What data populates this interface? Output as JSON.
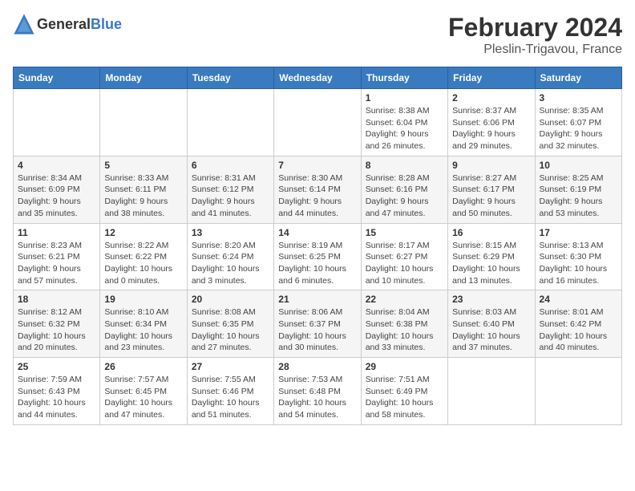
{
  "header": {
    "logo_general": "General",
    "logo_blue": "Blue",
    "main_title": "February 2024",
    "subtitle": "Pleslin-Trigavou, France"
  },
  "days_of_week": [
    "Sunday",
    "Monday",
    "Tuesday",
    "Wednesday",
    "Thursday",
    "Friday",
    "Saturday"
  ],
  "weeks": [
    [
      {
        "day": "",
        "info": ""
      },
      {
        "day": "",
        "info": ""
      },
      {
        "day": "",
        "info": ""
      },
      {
        "day": "",
        "info": ""
      },
      {
        "day": "1",
        "info": "Sunrise: 8:38 AM\nSunset: 6:04 PM\nDaylight: 9 hours and 26 minutes."
      },
      {
        "day": "2",
        "info": "Sunrise: 8:37 AM\nSunset: 6:06 PM\nDaylight: 9 hours and 29 minutes."
      },
      {
        "day": "3",
        "info": "Sunrise: 8:35 AM\nSunset: 6:07 PM\nDaylight: 9 hours and 32 minutes."
      }
    ],
    [
      {
        "day": "4",
        "info": "Sunrise: 8:34 AM\nSunset: 6:09 PM\nDaylight: 9 hours and 35 minutes."
      },
      {
        "day": "5",
        "info": "Sunrise: 8:33 AM\nSunset: 6:11 PM\nDaylight: 9 hours and 38 minutes."
      },
      {
        "day": "6",
        "info": "Sunrise: 8:31 AM\nSunset: 6:12 PM\nDaylight: 9 hours and 41 minutes."
      },
      {
        "day": "7",
        "info": "Sunrise: 8:30 AM\nSunset: 6:14 PM\nDaylight: 9 hours and 44 minutes."
      },
      {
        "day": "8",
        "info": "Sunrise: 8:28 AM\nSunset: 6:16 PM\nDaylight: 9 hours and 47 minutes."
      },
      {
        "day": "9",
        "info": "Sunrise: 8:27 AM\nSunset: 6:17 PM\nDaylight: 9 hours and 50 minutes."
      },
      {
        "day": "10",
        "info": "Sunrise: 8:25 AM\nSunset: 6:19 PM\nDaylight: 9 hours and 53 minutes."
      }
    ],
    [
      {
        "day": "11",
        "info": "Sunrise: 8:23 AM\nSunset: 6:21 PM\nDaylight: 9 hours and 57 minutes."
      },
      {
        "day": "12",
        "info": "Sunrise: 8:22 AM\nSunset: 6:22 PM\nDaylight: 10 hours and 0 minutes."
      },
      {
        "day": "13",
        "info": "Sunrise: 8:20 AM\nSunset: 6:24 PM\nDaylight: 10 hours and 3 minutes."
      },
      {
        "day": "14",
        "info": "Sunrise: 8:19 AM\nSunset: 6:25 PM\nDaylight: 10 hours and 6 minutes."
      },
      {
        "day": "15",
        "info": "Sunrise: 8:17 AM\nSunset: 6:27 PM\nDaylight: 10 hours and 10 minutes."
      },
      {
        "day": "16",
        "info": "Sunrise: 8:15 AM\nSunset: 6:29 PM\nDaylight: 10 hours and 13 minutes."
      },
      {
        "day": "17",
        "info": "Sunrise: 8:13 AM\nSunset: 6:30 PM\nDaylight: 10 hours and 16 minutes."
      }
    ],
    [
      {
        "day": "18",
        "info": "Sunrise: 8:12 AM\nSunset: 6:32 PM\nDaylight: 10 hours and 20 minutes."
      },
      {
        "day": "19",
        "info": "Sunrise: 8:10 AM\nSunset: 6:34 PM\nDaylight: 10 hours and 23 minutes."
      },
      {
        "day": "20",
        "info": "Sunrise: 8:08 AM\nSunset: 6:35 PM\nDaylight: 10 hours and 27 minutes."
      },
      {
        "day": "21",
        "info": "Sunrise: 8:06 AM\nSunset: 6:37 PM\nDaylight: 10 hours and 30 minutes."
      },
      {
        "day": "22",
        "info": "Sunrise: 8:04 AM\nSunset: 6:38 PM\nDaylight: 10 hours and 33 minutes."
      },
      {
        "day": "23",
        "info": "Sunrise: 8:03 AM\nSunset: 6:40 PM\nDaylight: 10 hours and 37 minutes."
      },
      {
        "day": "24",
        "info": "Sunrise: 8:01 AM\nSunset: 6:42 PM\nDaylight: 10 hours and 40 minutes."
      }
    ],
    [
      {
        "day": "25",
        "info": "Sunrise: 7:59 AM\nSunset: 6:43 PM\nDaylight: 10 hours and 44 minutes."
      },
      {
        "day": "26",
        "info": "Sunrise: 7:57 AM\nSunset: 6:45 PM\nDaylight: 10 hours and 47 minutes."
      },
      {
        "day": "27",
        "info": "Sunrise: 7:55 AM\nSunset: 6:46 PM\nDaylight: 10 hours and 51 minutes."
      },
      {
        "day": "28",
        "info": "Sunrise: 7:53 AM\nSunset: 6:48 PM\nDaylight: 10 hours and 54 minutes."
      },
      {
        "day": "29",
        "info": "Sunrise: 7:51 AM\nSunset: 6:49 PM\nDaylight: 10 hours and 58 minutes."
      },
      {
        "day": "",
        "info": ""
      },
      {
        "day": "",
        "info": ""
      }
    ]
  ]
}
